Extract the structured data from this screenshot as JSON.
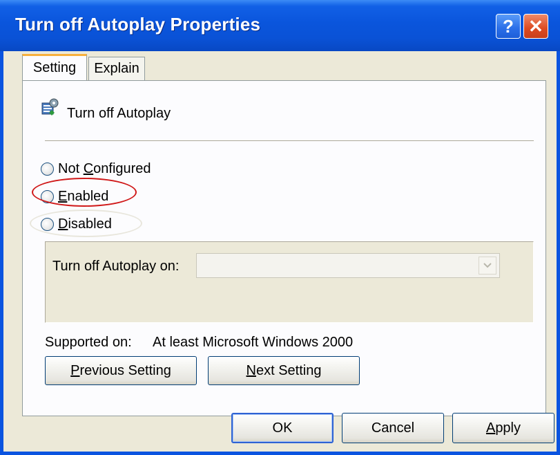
{
  "window": {
    "title": "Turn off Autoplay Properties",
    "help_symbol": "?",
    "close_symbol": "✕"
  },
  "tabs": [
    {
      "label": "Setting",
      "selected": true
    },
    {
      "label": "Explain",
      "selected": false
    }
  ],
  "policy": {
    "icon": "policy-settings-icon",
    "name": "Turn off Autoplay"
  },
  "options": {
    "radios": [
      {
        "pre": "Not ",
        "mnemonic": "C",
        "post": "onfigured",
        "selected": false
      },
      {
        "pre": "",
        "mnemonic": "E",
        "post": "nabled",
        "selected": false
      },
      {
        "pre": "",
        "mnemonic": "D",
        "post": "isabled",
        "selected": false
      }
    ],
    "dropdown_label": "Turn off Autoplay on:",
    "dropdown_value": ""
  },
  "supported": {
    "label": "Supported on:",
    "value": "At least Microsoft Windows 2000"
  },
  "nav": {
    "prev": {
      "mnemonic": "P",
      "rest": "revious Setting"
    },
    "next": {
      "mnemonic": "N",
      "rest": "ext Setting"
    }
  },
  "footer": {
    "ok": "OK",
    "cancel": "Cancel",
    "apply": {
      "mnemonic": "A",
      "rest": "pply"
    }
  },
  "colors": {
    "titlebar": "#0a55dc",
    "annotation_red": "#d01818"
  }
}
